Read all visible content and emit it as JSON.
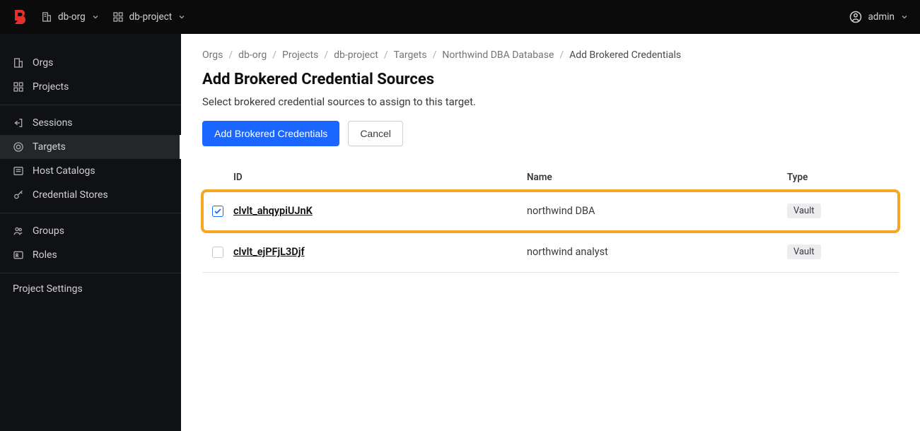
{
  "header": {
    "org": "db-org",
    "project": "db-project",
    "user": "admin"
  },
  "sidebar": {
    "group1": [
      {
        "label": "Orgs",
        "icon": "building"
      },
      {
        "label": "Projects",
        "icon": "grid"
      }
    ],
    "group2": [
      {
        "label": "Sessions",
        "icon": "exit"
      },
      {
        "label": "Targets",
        "icon": "target",
        "active": true
      },
      {
        "label": "Host Catalogs",
        "icon": "list"
      },
      {
        "label": "Credential Stores",
        "icon": "key"
      }
    ],
    "group3": [
      {
        "label": "Groups",
        "icon": "users"
      },
      {
        "label": "Roles",
        "icon": "id"
      }
    ],
    "settings": "Project Settings"
  },
  "breadcrumb": [
    "Orgs",
    "db-org",
    "Projects",
    "db-project",
    "Targets",
    "Northwind DBA Database",
    "Add Brokered Credentials"
  ],
  "page": {
    "title": "Add Brokered Credential Sources",
    "subtitle": "Select brokered credential sources to assign to this target.",
    "primary_btn": "Add Brokered Credentials",
    "cancel_btn": "Cancel"
  },
  "table": {
    "headers": {
      "id": "ID",
      "name": "Name",
      "type": "Type"
    },
    "rows": [
      {
        "id": "clvlt_ahqypiUJnK",
        "name": "northwind DBA",
        "type": "Vault",
        "checked": true,
        "highlighted": true
      },
      {
        "id": "clvlt_ejPFjL3Djf",
        "name": "northwind analyst",
        "type": "Vault",
        "checked": false,
        "highlighted": false
      }
    ]
  }
}
